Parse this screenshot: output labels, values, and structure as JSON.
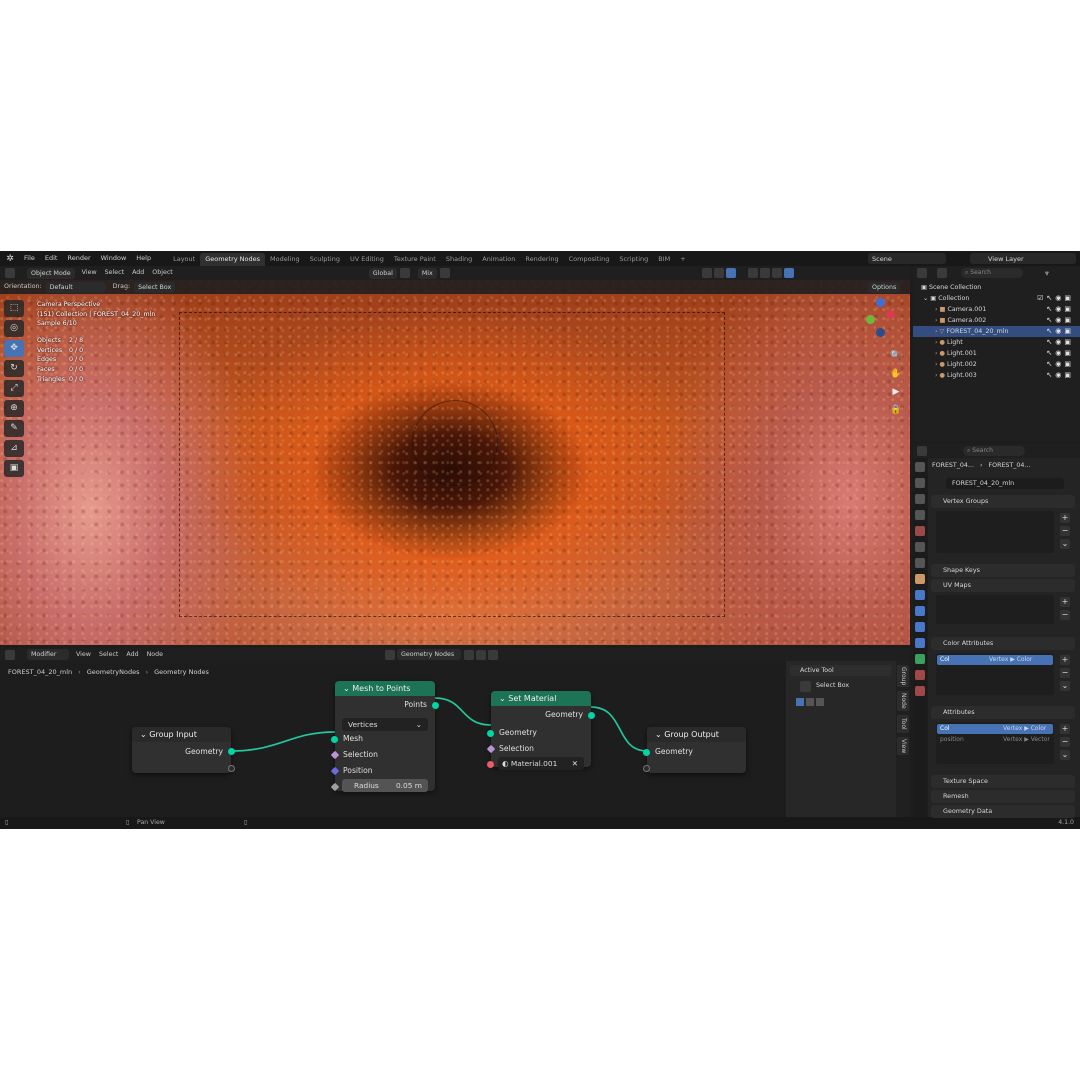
{
  "menubar": {
    "menus": [
      "File",
      "Edit",
      "Render",
      "Window",
      "Help"
    ],
    "workspaces": [
      "Layout",
      "Geometry Nodes",
      "Modeling",
      "Sculpting",
      "UV Editing",
      "Texture Paint",
      "Shading",
      "Animation",
      "Rendering",
      "Compositing",
      "Scripting",
      "BIM",
      "+"
    ],
    "active_workspace": "Geometry Nodes",
    "scene": "Scene",
    "view_layer": "View Layer"
  },
  "viewport_header": {
    "mode": "Object Mode",
    "menus": [
      "View",
      "Select",
      "Add",
      "Object"
    ],
    "transform": "Global",
    "snap": "Mix",
    "orientation_label": "Orientation:",
    "orientation": "Default",
    "drag_label": "Drag:",
    "drag": "Select Box",
    "options": "Options"
  },
  "viewport": {
    "perspective": "Camera Perspective",
    "collection": "(151) Collection | FOREST_04_20_mln",
    "sample": "Sample 6/10",
    "stats": [
      {
        "k": "Objects",
        "v": "2 / 8"
      },
      {
        "k": "Vertices",
        "v": "0 / 0"
      },
      {
        "k": "Edges",
        "v": "0 / 0"
      },
      {
        "k": "Faces",
        "v": "0 / 0"
      },
      {
        "k": "Triangles",
        "v": "0 / 0"
      }
    ]
  },
  "node_header": {
    "type": "Modifier",
    "menus": [
      "View",
      "Select",
      "Add",
      "Node"
    ],
    "tree": "Geometry Nodes"
  },
  "breadcrumb": [
    "FOREST_04_20_mln",
    "GeometryNodes",
    "Geometry Nodes"
  ],
  "nodes": {
    "group_input": {
      "title": "Group Input",
      "out": "Geometry"
    },
    "mesh_to_points": {
      "title": "Mesh to Points",
      "out": "Points",
      "mode": "Vertices",
      "in_mesh": "Mesh",
      "in_selection": "Selection",
      "in_position": "Position",
      "radius_label": "Radius",
      "radius_value": "0.05 m"
    },
    "set_material": {
      "title": "Set Material",
      "out": "Geometry",
      "in_geometry": "Geometry",
      "in_selection": "Selection",
      "material": "Material.001"
    },
    "group_output": {
      "title": "Group Output",
      "in": "Geometry"
    }
  },
  "node_sidebar": {
    "active_tool": "Active Tool",
    "tool": "Select Box",
    "tabs": [
      "Group",
      "Node",
      "Tool",
      "View"
    ]
  },
  "outliner": {
    "search": "Search",
    "scene_collection": "Scene Collection",
    "rows": [
      {
        "name": "Collection",
        "indent": 1,
        "sel": false
      },
      {
        "name": "Camera.001",
        "indent": 2,
        "sel": false
      },
      {
        "name": "Camera.002",
        "indent": 2,
        "sel": false
      },
      {
        "name": "FOREST_04_20_mln",
        "indent": 2,
        "sel": true
      },
      {
        "name": "Light",
        "indent": 2,
        "sel": false
      },
      {
        "name": "Light.001",
        "indent": 2,
        "sel": false
      },
      {
        "name": "Light.002",
        "indent": 2,
        "sel": false
      },
      {
        "name": "Light.003",
        "indent": 2,
        "sel": false
      }
    ]
  },
  "properties": {
    "search": "Search",
    "breadcrumb_a": "FOREST_04...",
    "breadcrumb_b": "FOREST_04...",
    "data_name": "FOREST_04_20_mln",
    "panels": {
      "vertex_groups": "Vertex Groups",
      "shape_keys": "Shape Keys",
      "uv_maps": "UV Maps",
      "color_attributes": "Color Attributes",
      "attributes": "Attributes",
      "texture_space": "Texture Space",
      "remesh": "Remesh",
      "geometry_data": "Geometry Data"
    },
    "color_attr": {
      "name": "Col",
      "domain": "Vertex ▶ Color"
    },
    "attrs": [
      {
        "name": "Col",
        "domain": "Vertex ▶ Color"
      },
      {
        "name": "position",
        "domain": "Vertex ▶ Vector"
      }
    ]
  },
  "statusbar": {
    "hint": "Pan View",
    "version": "4.1.0"
  },
  "colors": {
    "accent": "#4772b3",
    "node_green": "#1d7355",
    "geometry_socket": "#00d6a3",
    "material_socket": "#ee5b68"
  }
}
